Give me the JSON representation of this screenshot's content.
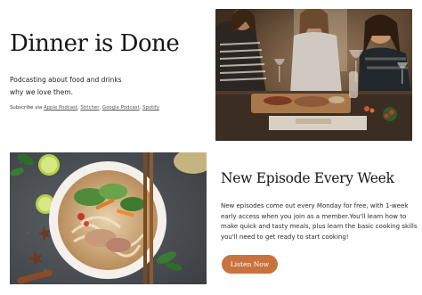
{
  "hero": {
    "title": "Dinner is Done",
    "description_lines": [
      "Podcasting about food and drinks",
      "why we love them."
    ],
    "subscribe": {
      "prefix": "Subscribe via",
      "links": [
        "Apple Podcast",
        "Stitcher",
        "Google Podcast",
        "Spotify"
      ]
    }
  },
  "episode": {
    "title": "New Episode Every Week",
    "description": "New episodes come out every Monday for free, with 1-week early access when you join as a member.You'll learn how to make quick and tasty meals, plus learn the basic cooking skills you'll need to get ready to start cooking!",
    "button_label": "Listen Now"
  },
  "colors": {
    "accent": "#c8733e"
  }
}
